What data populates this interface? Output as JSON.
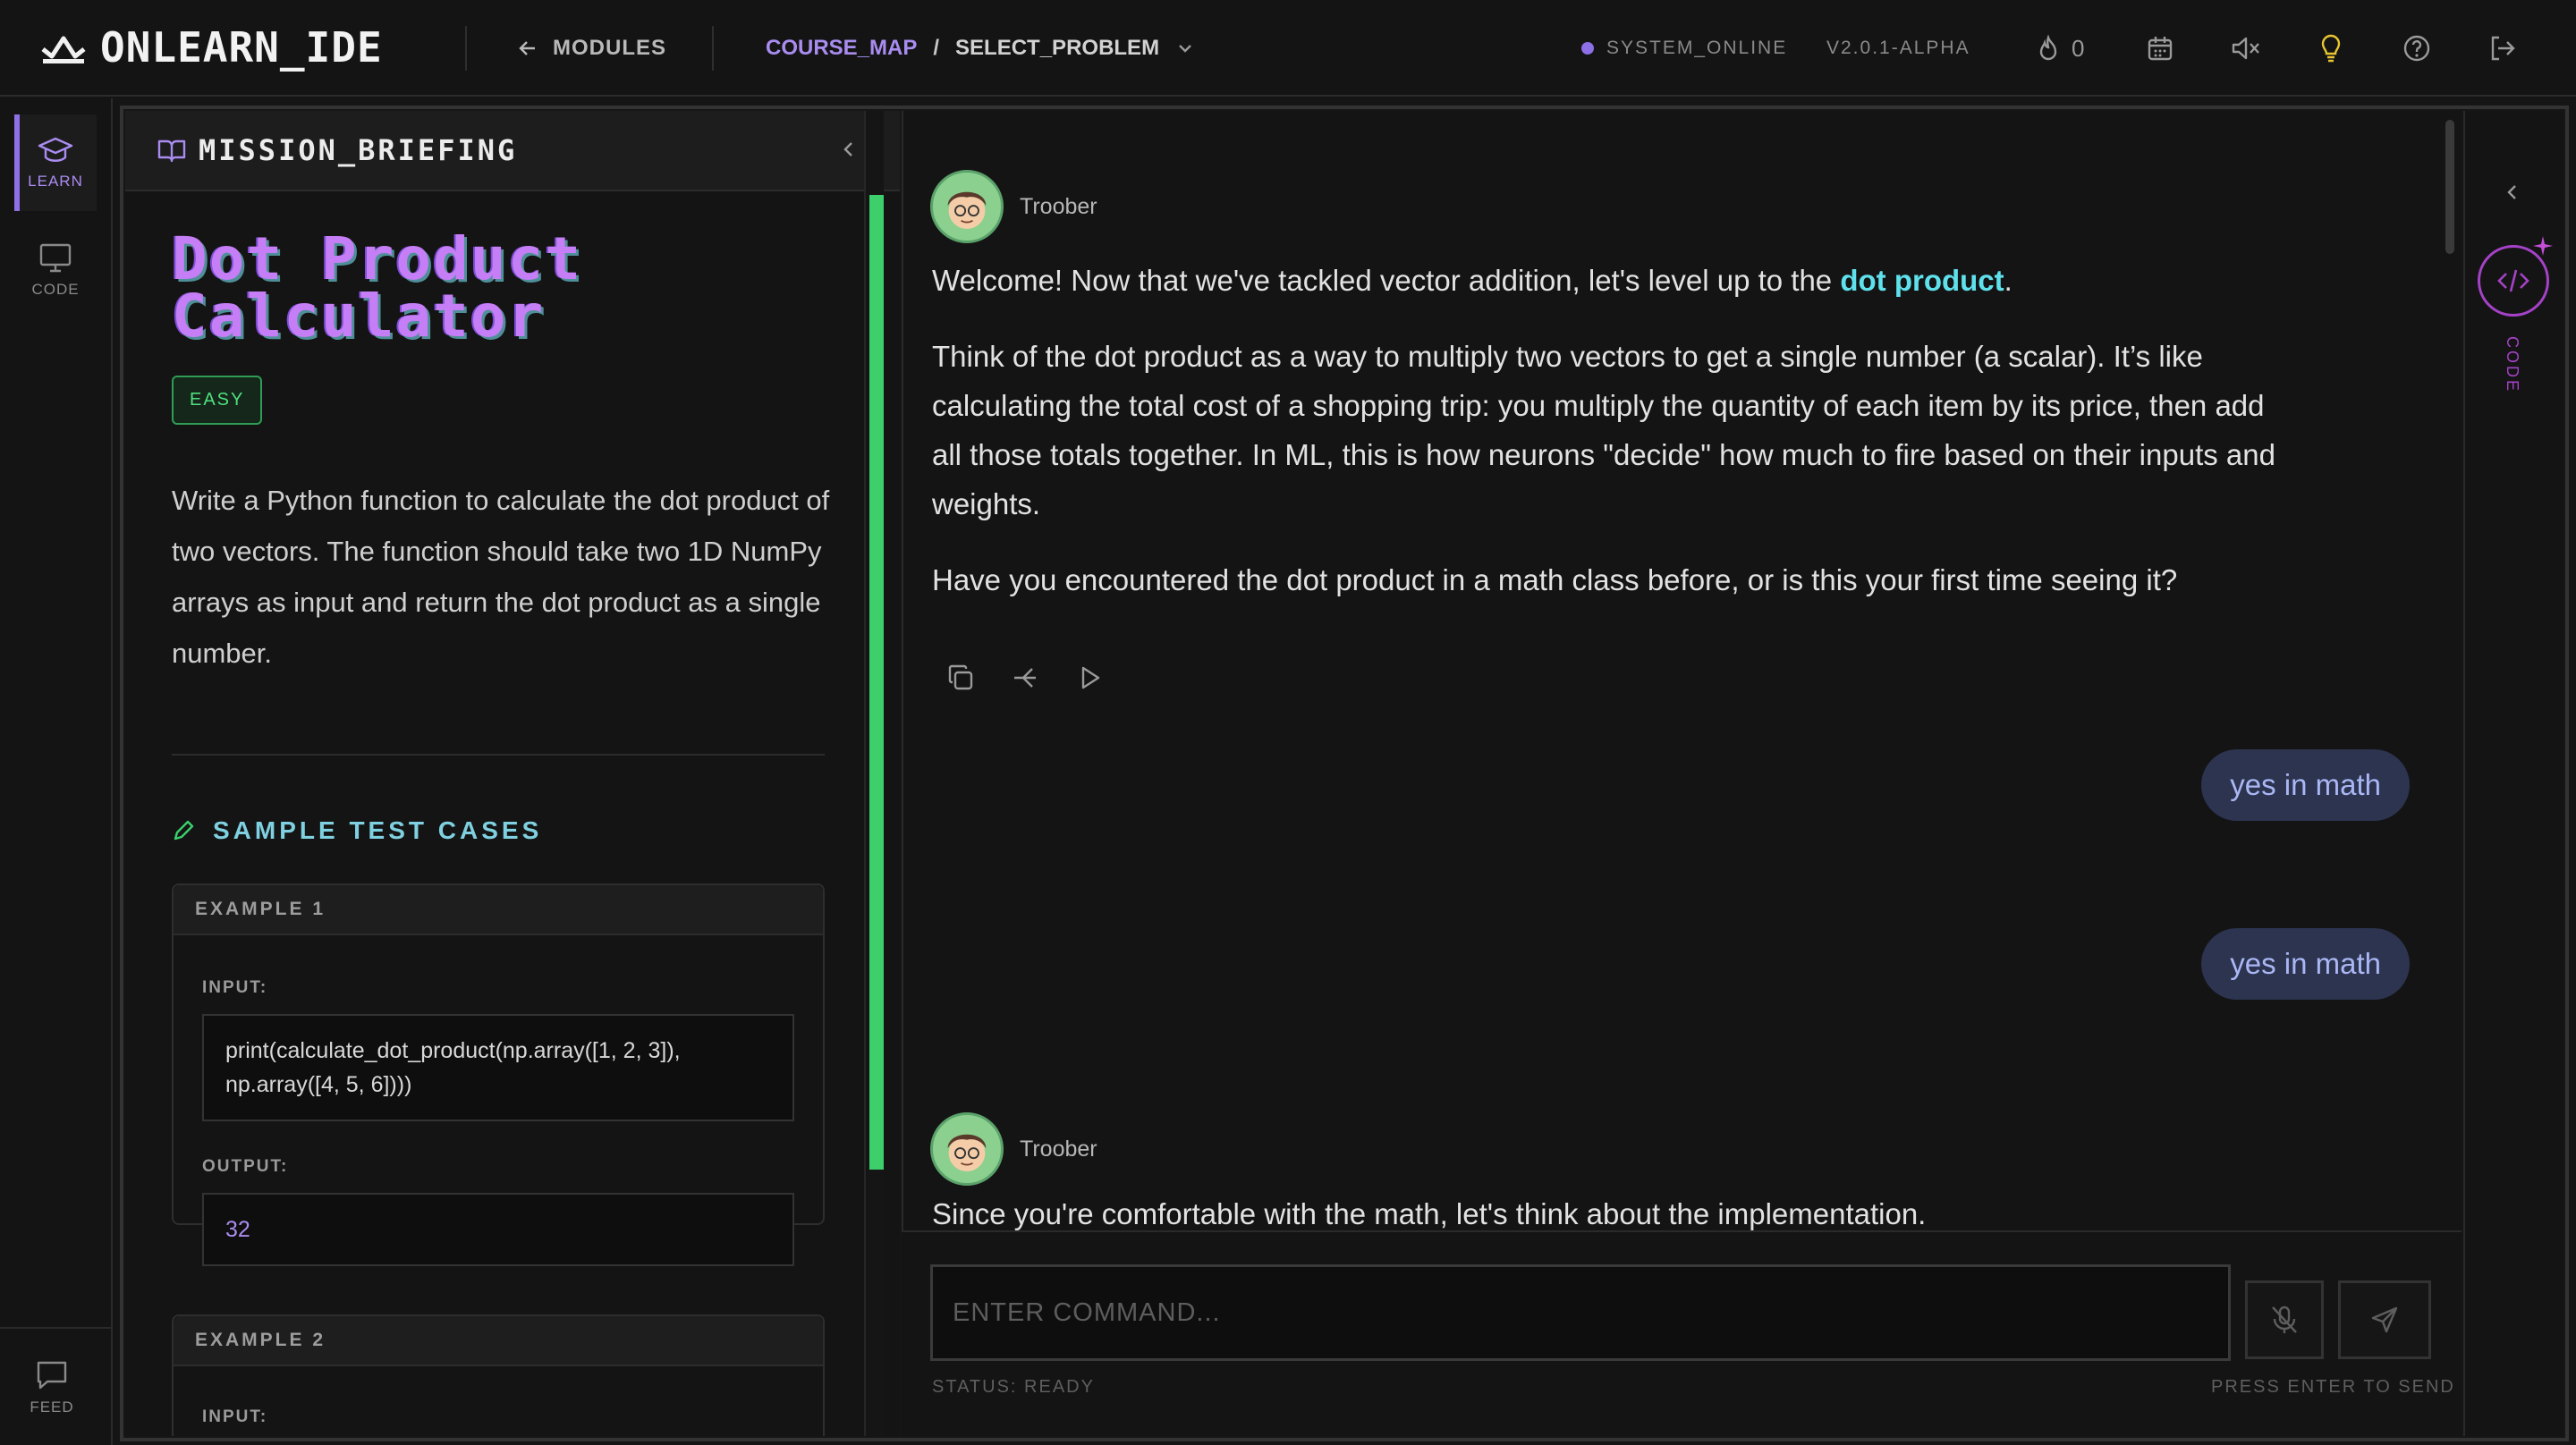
{
  "app": {
    "logo_text": "ONLEARN_IDE"
  },
  "header": {
    "back_label": "MODULES",
    "breadcrumb": {
      "link": "COURSE_MAP",
      "separator": "/",
      "current": "SELECT_PROBLEM"
    },
    "system_status": "SYSTEM_ONLINE",
    "version": "V2.0.1-ALPHA",
    "streak_count": "0"
  },
  "left_rail": {
    "items": [
      {
        "label": "LEARN",
        "icon": "graduation-cap-icon",
        "active": true
      },
      {
        "label": "CODE",
        "icon": "monitor-icon",
        "active": false
      }
    ],
    "bottom": {
      "label": "FEED",
      "icon": "chat-bubble-icon"
    }
  },
  "briefing": {
    "header_title": "MISSION_BRIEFING",
    "problem_title_line1": "Dot Product",
    "problem_title_line2": "Calculator",
    "difficulty": "EASY",
    "description": "Write a Python function to calculate the dot product of two vectors. The function should take two 1D NumPy arrays as input and return the dot product as a single number.",
    "sample_heading": "SAMPLE TEST CASES",
    "examples": [
      {
        "title": "EXAMPLE 1",
        "input_label": "INPUT:",
        "input": "print(calculate_dot_product(np.array([1, 2, 3]), np.array([4, 5, 6])))",
        "output_label": "OUTPUT:",
        "output": "32"
      },
      {
        "title": "EXAMPLE 2",
        "input_label": "INPUT:"
      }
    ]
  },
  "chat": {
    "messages": [
      {
        "author": "Troober",
        "p1_before": "Welcome! Now that we've tackled vector addition, let's level up to the ",
        "p1_highlight": "dot product",
        "p1_after": ".",
        "p2": "Think of the dot product as a way to multiply two vectors to get a single number (a scalar). It’s like calculating the total cost of a shopping trip: you multiply the quantity of each item by its price, then add all those totals together. In ML, this is how neurons \"decide\" how much to fire based on their inputs and weights.",
        "p3": "Have you encountered the dot product in a math class before, or is this your first time seeing it?"
      },
      {
        "user": "yes in math"
      },
      {
        "user": "yes in math"
      },
      {
        "author": "Troober",
        "p1": "Since you're comfortable with the math, let's think about the implementation."
      }
    ],
    "input_placeholder": "ENTER COMMAND...",
    "status": "STATUS: READY",
    "hint": "PRESS ENTER TO SEND"
  },
  "right_rail": {
    "code_label": "CODE"
  },
  "colors": {
    "accent_purple": "#a98cf0",
    "accent_cyan": "#5fe1ec",
    "success_green": "#3ccf6c",
    "magenta": "#a542c8"
  }
}
